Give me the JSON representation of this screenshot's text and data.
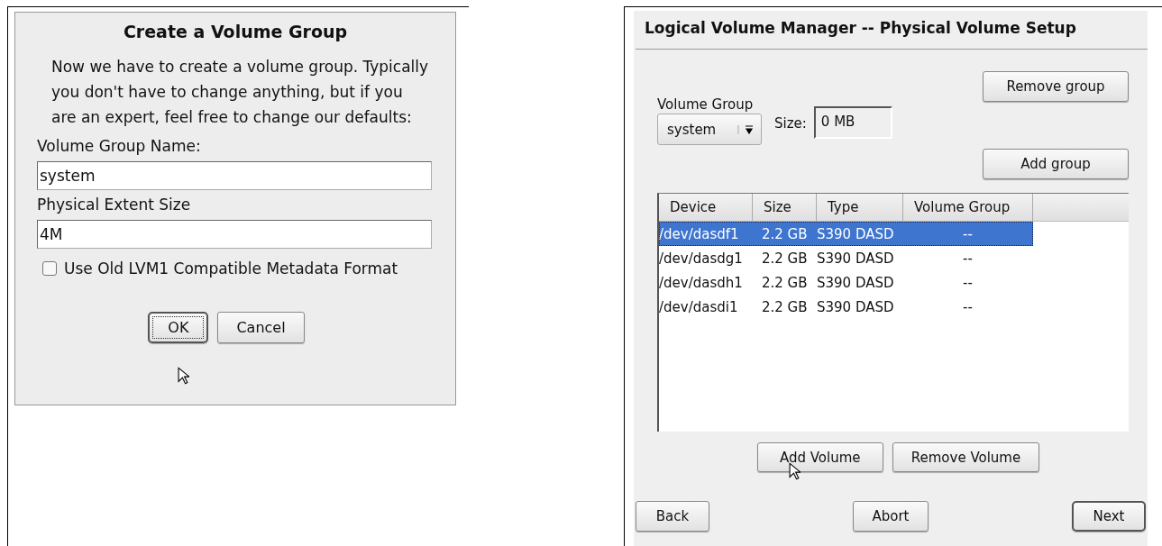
{
  "create_dialog": {
    "title": "Create a Volume Group",
    "intro": "Now we have to create a volume group. Typically you don't have to change anything, but if you are an expert, feel free to change our defaults:",
    "fields": [
      {
        "label": "Volume Group Name:",
        "value": "system"
      },
      {
        "label": "Physical Extent Size",
        "value": "4M"
      }
    ],
    "checkbox": {
      "label": "Use Old LVM1 Compatible Metadata Format",
      "checked": false
    },
    "buttons": [
      {
        "label": "OK",
        "default": true
      },
      {
        "label": "Cancel",
        "default": false
      }
    ]
  },
  "setup_window": {
    "title": "Logical Volume Manager -- Physical Volume Setup",
    "volume_group": {
      "label": "Volume Group",
      "value": "system"
    },
    "size": {
      "label": "Size:",
      "value": "0 MB"
    },
    "group_buttons": [
      "Remove group",
      "Add group"
    ],
    "table": {
      "columns": [
        "Device",
        "Size",
        "Type",
        "Volume Group"
      ],
      "rows": [
        {
          "cells": [
            "/dev/dasdf1",
            "2.2 GB",
            "S390 DASD",
            "--"
          ],
          "selected": true
        },
        {
          "cells": [
            "/dev/dasdg1",
            "2.2 GB",
            "S390 DASD",
            "--"
          ],
          "selected": false
        },
        {
          "cells": [
            "/dev/dasdh1",
            "2.2 GB",
            "S390 DASD",
            "--"
          ],
          "selected": false
        },
        {
          "cells": [
            "/dev/dasdi1",
            "2.2 GB",
            "S390 DASD",
            "--"
          ],
          "selected": false
        }
      ]
    },
    "volume_buttons": [
      "Add Volume",
      "Remove Volume"
    ],
    "nav_buttons": [
      {
        "label": "Back",
        "default": false
      },
      {
        "label": "Abort",
        "default": false
      },
      {
        "label": "Next",
        "default": true
      }
    ]
  }
}
